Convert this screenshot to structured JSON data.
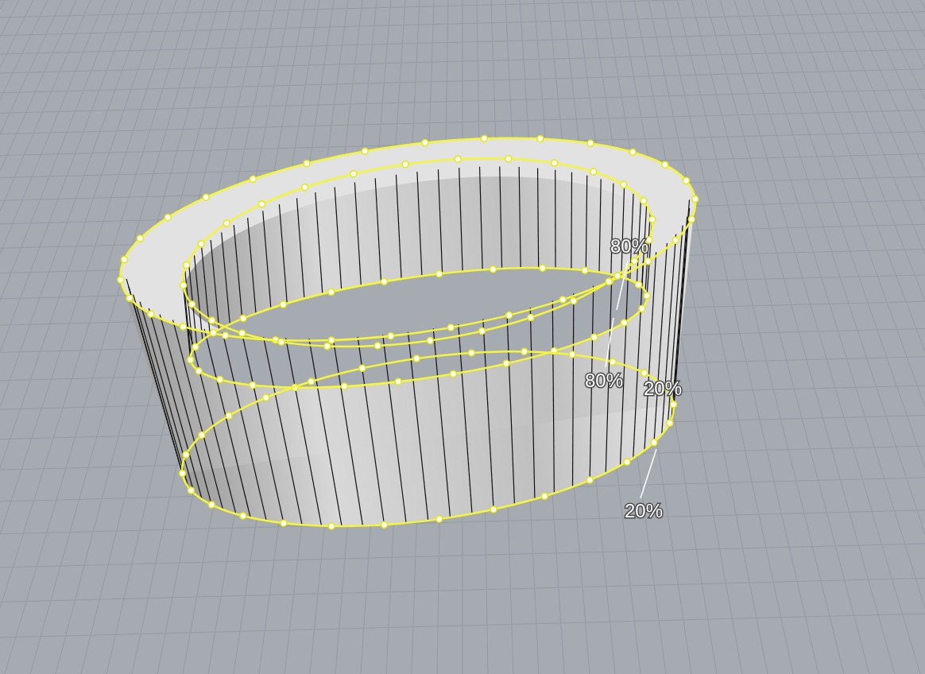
{
  "viewport": {
    "labels": [
      {
        "text": "80%"
      },
      {
        "text": "80%"
      },
      {
        "text": "20%"
      },
      {
        "text": "20%"
      }
    ]
  }
}
